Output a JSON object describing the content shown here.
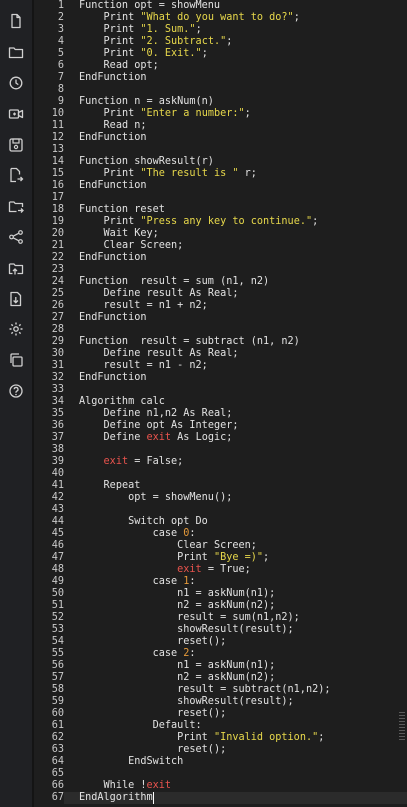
{
  "sidebar": {
    "buttons": [
      {
        "name": "new-file-icon"
      },
      {
        "name": "open-folder-icon"
      },
      {
        "name": "history-icon"
      },
      {
        "name": "run-icon"
      },
      {
        "name": "save-icon"
      },
      {
        "name": "save-as-icon"
      },
      {
        "name": "export-folder-icon"
      },
      {
        "name": "share-icon"
      },
      {
        "name": "upload-folder-icon"
      },
      {
        "name": "download-icon"
      },
      {
        "name": "settings-icon"
      },
      {
        "name": "copy-icon"
      },
      {
        "name": "help-icon"
      }
    ]
  },
  "colors": {
    "sidebar_bg": "#202124",
    "editor_bg": "#1e1e1e",
    "string": "#e7d84b",
    "keyword_red": "#e8534d",
    "number": "#e59a3a",
    "text": "#e2e2e2"
  },
  "editor": {
    "current_line": 67,
    "lines": [
      {
        "n": "1",
        "indent": "",
        "parts": [
          [
            "t",
            "Function opt = showMenu"
          ]
        ]
      },
      {
        "n": "2",
        "indent": "    ",
        "parts": [
          [
            "t",
            "Print "
          ],
          [
            "s",
            "\"What do you want to do?\""
          ],
          [
            "t",
            ";"
          ]
        ]
      },
      {
        "n": "3",
        "indent": "    ",
        "parts": [
          [
            "t",
            "Print "
          ],
          [
            "s",
            "\"1. Sum.\""
          ],
          [
            "t",
            ";"
          ]
        ]
      },
      {
        "n": "4",
        "indent": "    ",
        "parts": [
          [
            "t",
            "Print "
          ],
          [
            "s",
            "\"2. Subtract.\""
          ],
          [
            "t",
            ";"
          ]
        ]
      },
      {
        "n": "5",
        "indent": "    ",
        "parts": [
          [
            "t",
            "Print "
          ],
          [
            "s",
            "\"0. Exit.\""
          ],
          [
            "t",
            ";"
          ]
        ]
      },
      {
        "n": "6",
        "indent": "    ",
        "parts": [
          [
            "t",
            "Read opt;"
          ]
        ]
      },
      {
        "n": "7",
        "indent": "",
        "parts": [
          [
            "t",
            "EndFunction"
          ]
        ]
      },
      {
        "n": "8",
        "indent": "",
        "parts": [
          [
            "t",
            ""
          ]
        ]
      },
      {
        "n": "9",
        "indent": "",
        "parts": [
          [
            "t",
            "Function n = askNum(n)"
          ]
        ]
      },
      {
        "n": "10",
        "indent": "    ",
        "parts": [
          [
            "t",
            "Print "
          ],
          [
            "s",
            "\"Enter a number:\""
          ],
          [
            "t",
            ";"
          ]
        ]
      },
      {
        "n": "11",
        "indent": "    ",
        "parts": [
          [
            "t",
            "Read n;"
          ]
        ]
      },
      {
        "n": "12",
        "indent": "",
        "parts": [
          [
            "t",
            "EndFunction"
          ]
        ]
      },
      {
        "n": "13",
        "indent": "",
        "parts": [
          [
            "t",
            ""
          ]
        ]
      },
      {
        "n": "14",
        "indent": "",
        "parts": [
          [
            "t",
            "Function showResult(r)"
          ]
        ]
      },
      {
        "n": "15",
        "indent": "    ",
        "parts": [
          [
            "t",
            "Print "
          ],
          [
            "s",
            "\"The result is \""
          ],
          [
            "t",
            " r;"
          ]
        ]
      },
      {
        "n": "16",
        "indent": "",
        "parts": [
          [
            "t",
            "EndFunction"
          ]
        ]
      },
      {
        "n": "17",
        "indent": "",
        "parts": [
          [
            "t",
            ""
          ]
        ]
      },
      {
        "n": "18",
        "indent": "",
        "parts": [
          [
            "t",
            "Function reset"
          ]
        ]
      },
      {
        "n": "19",
        "indent": "    ",
        "parts": [
          [
            "t",
            "Print "
          ],
          [
            "s",
            "\"Press any key to continue.\""
          ],
          [
            "t",
            ";"
          ]
        ]
      },
      {
        "n": "20",
        "indent": "    ",
        "parts": [
          [
            "t",
            "Wait Key;"
          ]
        ]
      },
      {
        "n": "21",
        "indent": "    ",
        "parts": [
          [
            "t",
            "Clear Screen;"
          ]
        ]
      },
      {
        "n": "22",
        "indent": "",
        "parts": [
          [
            "t",
            "EndFunction"
          ]
        ]
      },
      {
        "n": "23",
        "indent": "",
        "parts": [
          [
            "t",
            ""
          ]
        ]
      },
      {
        "n": "24",
        "indent": "",
        "parts": [
          [
            "t",
            "Function  result = sum (n1, n2)"
          ]
        ]
      },
      {
        "n": "25",
        "indent": "    ",
        "parts": [
          [
            "t",
            "Define result As Real;"
          ]
        ]
      },
      {
        "n": "26",
        "indent": "    ",
        "parts": [
          [
            "t",
            "result = n1 + n2;"
          ]
        ]
      },
      {
        "n": "27",
        "indent": "",
        "parts": [
          [
            "t",
            "EndFunction"
          ]
        ]
      },
      {
        "n": "28",
        "indent": "",
        "parts": [
          [
            "t",
            ""
          ]
        ]
      },
      {
        "n": "29",
        "indent": "",
        "parts": [
          [
            "t",
            "Function  result = subtract (n1, n2)"
          ]
        ]
      },
      {
        "n": "30",
        "indent": "    ",
        "parts": [
          [
            "t",
            "Define result As Real;"
          ]
        ]
      },
      {
        "n": "31",
        "indent": "    ",
        "parts": [
          [
            "t",
            "result = n1 - n2;"
          ]
        ]
      },
      {
        "n": "32",
        "indent": "",
        "parts": [
          [
            "t",
            "EndFunction"
          ]
        ]
      },
      {
        "n": "33",
        "indent": "",
        "parts": [
          [
            "t",
            ""
          ]
        ]
      },
      {
        "n": "34",
        "indent": "",
        "parts": [
          [
            "t",
            "Algorithm calc"
          ]
        ]
      },
      {
        "n": "35",
        "indent": "    ",
        "parts": [
          [
            "t",
            "Define n1,n2 As Real;"
          ]
        ]
      },
      {
        "n": "36",
        "indent": "    ",
        "parts": [
          [
            "t",
            "Define opt As Integer;"
          ]
        ]
      },
      {
        "n": "37",
        "indent": "    ",
        "parts": [
          [
            "t",
            "Define "
          ],
          [
            "r",
            "exit"
          ],
          [
            "t",
            " As Logic;"
          ]
        ]
      },
      {
        "n": "38",
        "indent": "",
        "parts": [
          [
            "t",
            ""
          ]
        ]
      },
      {
        "n": "39",
        "indent": "    ",
        "parts": [
          [
            "r",
            "exit"
          ],
          [
            "t",
            " = False;"
          ]
        ]
      },
      {
        "n": "40",
        "indent": "",
        "parts": [
          [
            "t",
            ""
          ]
        ]
      },
      {
        "n": "41",
        "indent": "    ",
        "parts": [
          [
            "t",
            "Repeat"
          ]
        ]
      },
      {
        "n": "42",
        "indent": "        ",
        "parts": [
          [
            "t",
            "opt = showMenu();"
          ]
        ]
      },
      {
        "n": "43",
        "indent": "",
        "parts": [
          [
            "t",
            ""
          ]
        ]
      },
      {
        "n": "44",
        "indent": "        ",
        "parts": [
          [
            "t",
            "Switch opt Do"
          ]
        ]
      },
      {
        "n": "45",
        "indent": "            ",
        "parts": [
          [
            "t",
            "case "
          ],
          [
            "o",
            "0"
          ],
          [
            "t",
            ":"
          ]
        ]
      },
      {
        "n": "46",
        "indent": "                ",
        "parts": [
          [
            "t",
            "Clear Screen;"
          ]
        ]
      },
      {
        "n": "47",
        "indent": "                ",
        "parts": [
          [
            "t",
            "Print "
          ],
          [
            "s",
            "\"Bye =)\""
          ],
          [
            "t",
            ";"
          ]
        ]
      },
      {
        "n": "48",
        "indent": "                ",
        "parts": [
          [
            "r",
            "exit"
          ],
          [
            "t",
            " = True;"
          ]
        ]
      },
      {
        "n": "49",
        "indent": "            ",
        "parts": [
          [
            "t",
            "case "
          ],
          [
            "o",
            "1"
          ],
          [
            "t",
            ":"
          ]
        ]
      },
      {
        "n": "50",
        "indent": "                ",
        "parts": [
          [
            "t",
            "n1 = askNum(n1);"
          ]
        ]
      },
      {
        "n": "51",
        "indent": "                ",
        "parts": [
          [
            "t",
            "n2 = askNum(n2);"
          ]
        ]
      },
      {
        "n": "52",
        "indent": "                ",
        "parts": [
          [
            "t",
            "result = sum(n1,n2);"
          ]
        ]
      },
      {
        "n": "53",
        "indent": "                ",
        "parts": [
          [
            "t",
            "showResult(result);"
          ]
        ]
      },
      {
        "n": "54",
        "indent": "                ",
        "parts": [
          [
            "t",
            "reset();"
          ]
        ]
      },
      {
        "n": "55",
        "indent": "            ",
        "parts": [
          [
            "t",
            "case "
          ],
          [
            "o",
            "2"
          ],
          [
            "t",
            ":"
          ]
        ]
      },
      {
        "n": "56",
        "indent": "                ",
        "parts": [
          [
            "t",
            "n1 = askNum(n1);"
          ]
        ]
      },
      {
        "n": "57",
        "indent": "                ",
        "parts": [
          [
            "t",
            "n2 = askNum(n2);"
          ]
        ]
      },
      {
        "n": "58",
        "indent": "                ",
        "parts": [
          [
            "t",
            "result = subtract(n1,n2);"
          ]
        ]
      },
      {
        "n": "59",
        "indent": "                ",
        "parts": [
          [
            "t",
            "showResult(result);"
          ]
        ]
      },
      {
        "n": "60",
        "indent": "                ",
        "parts": [
          [
            "t",
            "reset();"
          ]
        ]
      },
      {
        "n": "61",
        "indent": "            ",
        "parts": [
          [
            "t",
            "Default:"
          ]
        ]
      },
      {
        "n": "62",
        "indent": "                ",
        "parts": [
          [
            "t",
            "Print "
          ],
          [
            "s",
            "\"Invalid option.\""
          ],
          [
            "t",
            ";"
          ]
        ]
      },
      {
        "n": "63",
        "indent": "                ",
        "parts": [
          [
            "t",
            "reset();"
          ]
        ]
      },
      {
        "n": "64",
        "indent": "        ",
        "parts": [
          [
            "t",
            "EndSwitch"
          ]
        ]
      },
      {
        "n": "65",
        "indent": "",
        "parts": [
          [
            "t",
            ""
          ]
        ]
      },
      {
        "n": "66",
        "indent": "    ",
        "parts": [
          [
            "t",
            "While !"
          ],
          [
            "r",
            "exit"
          ]
        ]
      },
      {
        "n": "67",
        "indent": "",
        "parts": [
          [
            "t",
            "EndAlgorithm"
          ]
        ]
      }
    ]
  }
}
